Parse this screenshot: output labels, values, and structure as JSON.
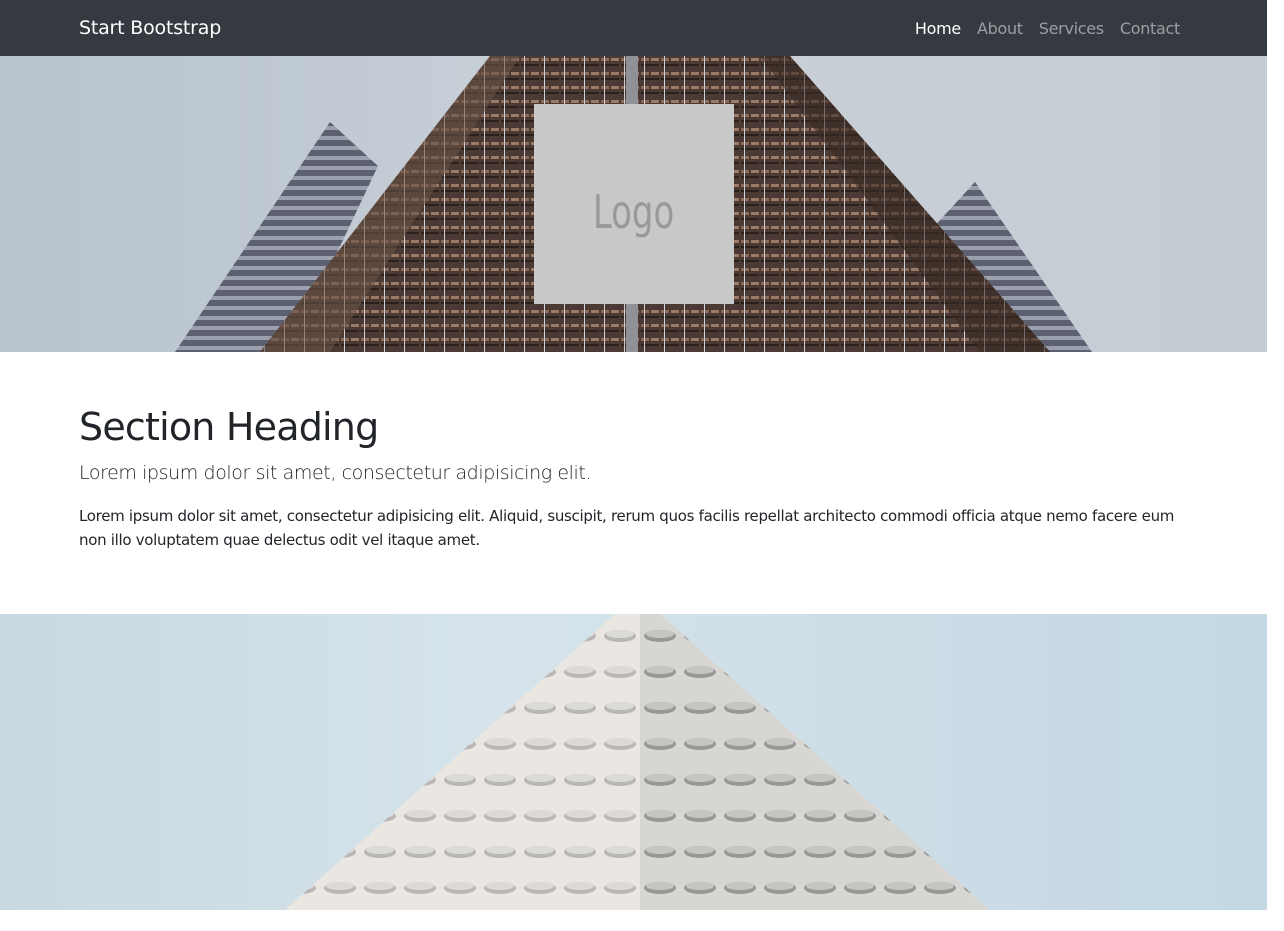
{
  "navbar": {
    "brand": "Start Bootstrap",
    "links": [
      {
        "label": "Home",
        "active": true
      },
      {
        "label": "About",
        "active": false
      },
      {
        "label": "Services",
        "active": false
      },
      {
        "label": "Contact",
        "active": false
      }
    ]
  },
  "hero": {
    "logo_text": "Logo"
  },
  "section": {
    "heading": "Section Heading",
    "lead": "Lorem ipsum dolor sit amet, consectetur adipisicing elit.",
    "body": "Lorem ipsum dolor sit amet, consectetur adipisicing elit. Aliquid, suscipit, rerum quos facilis repellat architecto commodi officia atque nemo facere eum non illo voluptatem quae delectus odit vel itaque amet."
  },
  "colors": {
    "navbar_bg": "#343a40",
    "logo_bg": "#c8c8c8"
  }
}
